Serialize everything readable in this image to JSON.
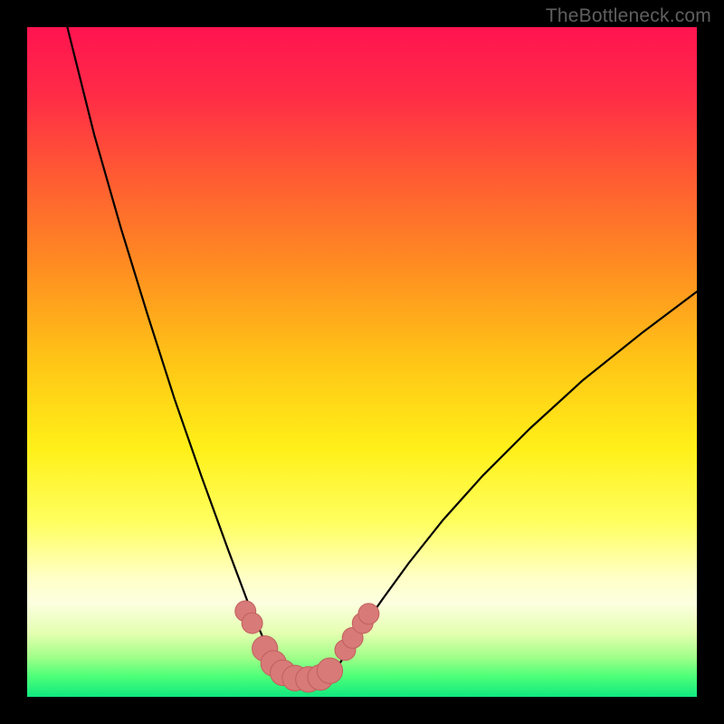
{
  "watermark": "TheBottleneck.com",
  "colors": {
    "black": "#000000",
    "curve": "#000000",
    "dotFill": "#d77a78",
    "dotStroke": "#c25f5d",
    "watermark": "#5f5f5f"
  },
  "gradient_stops": [
    {
      "offset": 0.0,
      "color": "#ff1450"
    },
    {
      "offset": 0.1,
      "color": "#ff2b47"
    },
    {
      "offset": 0.22,
      "color": "#ff5a33"
    },
    {
      "offset": 0.35,
      "color": "#ff8a22"
    },
    {
      "offset": 0.5,
      "color": "#ffc516"
    },
    {
      "offset": 0.63,
      "color": "#fff019"
    },
    {
      "offset": 0.74,
      "color": "#ffff60"
    },
    {
      "offset": 0.82,
      "color": "#ffffc4"
    },
    {
      "offset": 0.86,
      "color": "#fcffe0"
    },
    {
      "offset": 0.905,
      "color": "#e4ffb0"
    },
    {
      "offset": 0.94,
      "color": "#a3ff8a"
    },
    {
      "offset": 0.97,
      "color": "#4cff78"
    },
    {
      "offset": 1.0,
      "color": "#10e880"
    }
  ],
  "chart_data": {
    "type": "line",
    "title": "",
    "xlabel": "",
    "ylabel": "",
    "x_range": [
      0,
      100
    ],
    "y_range": [
      0,
      100
    ],
    "series": [
      {
        "name": "left-branch",
        "x": [
          6,
          10,
          14,
          18,
          22,
          26,
          28,
          30,
          31.5,
          33,
          34.5,
          36,
          37.2
        ],
        "y": [
          100,
          84,
          70,
          57,
          44.5,
          33,
          27.5,
          22,
          18,
          14,
          10.5,
          7,
          4
        ]
      },
      {
        "name": "right-branch",
        "x": [
          46,
          48,
          50,
          53,
          57,
          62,
          68,
          75,
          83,
          92,
          100
        ],
        "y": [
          4,
          7,
          10.2,
          14.5,
          20,
          26.3,
          33,
          40,
          47.3,
          54.5,
          60.5
        ]
      }
    ],
    "dots": [
      {
        "x": 32.6,
        "y": 12.8,
        "r": 1.4
      },
      {
        "x": 33.6,
        "y": 11.0,
        "r": 1.4
      },
      {
        "x": 35.5,
        "y": 7.2,
        "r": 1.9
      },
      {
        "x": 36.8,
        "y": 5.0,
        "r": 1.9
      },
      {
        "x": 38.2,
        "y": 3.6,
        "r": 1.9
      },
      {
        "x": 40.0,
        "y": 2.8,
        "r": 1.9
      },
      {
        "x": 42.0,
        "y": 2.6,
        "r": 1.9
      },
      {
        "x": 43.8,
        "y": 2.9,
        "r": 1.9
      },
      {
        "x": 45.2,
        "y": 3.9,
        "r": 1.9
      },
      {
        "x": 47.5,
        "y": 7.0,
        "r": 1.4
      },
      {
        "x": 48.6,
        "y": 8.8,
        "r": 1.4
      },
      {
        "x": 50.1,
        "y": 11.0,
        "r": 1.4
      },
      {
        "x": 51.0,
        "y": 12.4,
        "r": 1.4
      }
    ]
  }
}
